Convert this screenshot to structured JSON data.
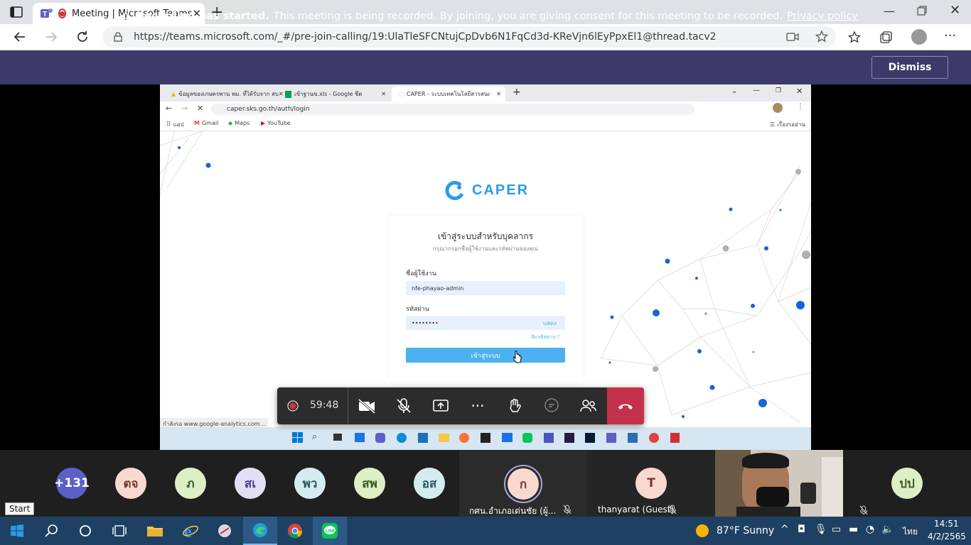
{
  "browser": {
    "tab_title": "Meeting | Microsoft Teams",
    "url": "https://teams.microsoft.com/_#/pre-join-calling/19:UlaTleSFCNtujCpDvb6N1FqCd3d-KReVjn6lEyPpxEl1@thread.tacv2"
  },
  "banner": {
    "bold": "Recording has started.",
    "text": "This meeting is being recorded. By joining, you are giving consent for this meeting to be recorded.",
    "link": "Privacy policy",
    "dismiss": "Dismiss"
  },
  "shared_screen": {
    "tabs": [
      "ข้อมูลของเกษตรพาน พม. ที่ได้รับจาก สบ",
      "เข้าฐานข.xls - Google ชีต",
      "CAPER - ระบบเทคโนโลยีสารสนเทศ CAPER"
    ],
    "url": "caper.sks.go.th/auth/login",
    "bookmarks": [
      "แอป",
      "Gmail",
      "Maps",
      "YouTube"
    ],
    "reading_list": "เรื่องรออ่าน",
    "logo": "CAPER",
    "login_title": "เข้าสู่ระบบสำหรับบุคลากร",
    "login_subtitle": "กรุณากรอกชื่อผู้ใช้งานและรหัสผ่านของคุณ",
    "username_label": "ชื่อผู้ใช้งาน",
    "username_value": "nfe-phayao-admin",
    "password_label": "รหัสผ่าน",
    "password_value": "••••••••",
    "show_label": "แสดง",
    "forgot_label": "ลืมรหัสผ่าน ?",
    "login_button": "เข้าสู่ระบบ",
    "status_tip": "กำลังรอ www.google-analytics.com..."
  },
  "controls": {
    "timer": "59:48"
  },
  "participants": [
    {
      "initials": "+131",
      "color": "#5b5fc7",
      "text_color": "#ffffff"
    },
    {
      "initials": "ตจ",
      "color": "#f8d9d0",
      "text_color": "#7a3a2a"
    },
    {
      "initials": "ภ",
      "color": "#dcefc5",
      "text_color": "#3d5a1e"
    },
    {
      "initials": "สเ",
      "color": "#e1def5",
      "text_color": "#4a3f8c"
    },
    {
      "initials": "พว",
      "color": "#d4ecef",
      "text_color": "#2a5860"
    },
    {
      "initials": "สพ",
      "color": "#dcefc5",
      "text_color": "#3d5a1e"
    },
    {
      "initials": "อส",
      "color": "#d4ecef",
      "text_color": "#2a5860"
    }
  ],
  "speaker": {
    "initial": "ก",
    "name": "กศน.อำเภอเด่นชัย (ผู้..."
  },
  "guest": {
    "initial": "T",
    "name": "thanyarat (Guest)"
  },
  "last": {
    "initials": "ปป"
  },
  "taskbar": {
    "start_tip": "Start",
    "weather": "87°F  Sunny",
    "lang": "ไทย",
    "time": "14:51",
    "date": "4/2/2565"
  }
}
